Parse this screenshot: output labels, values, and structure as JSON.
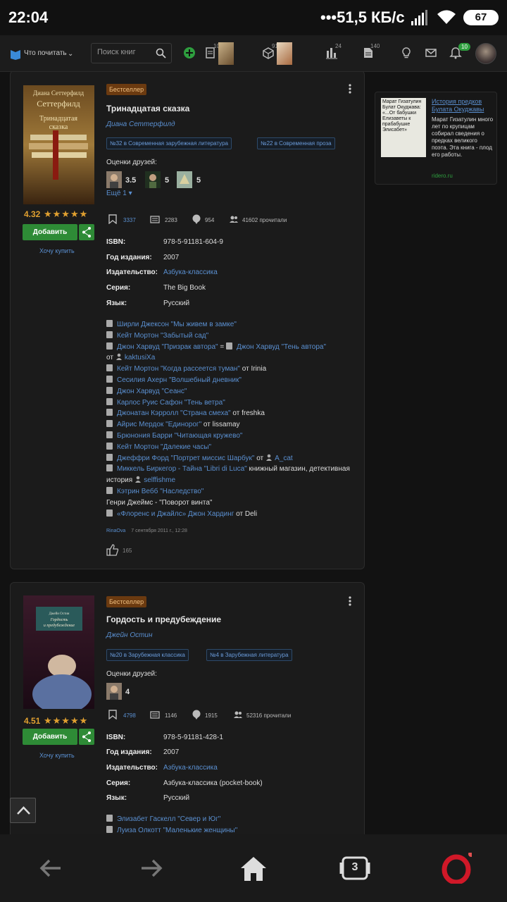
{
  "status": {
    "time": "22:04",
    "network": "•••51,5 КБ/с",
    "battery": "67"
  },
  "nav": {
    "title": "Что почитать",
    "search_placeholder": "Поиск книг",
    "counts": {
      "books": "101",
      "shelf": "91",
      "stats": "24",
      "quotes": "140"
    },
    "notif_badge": "10"
  },
  "books": [
    {
      "tag": "Бестселлер",
      "title": "Тринадцатая сказка",
      "author": "Диана Сеттерфилд",
      "cover_author": "Диана Сеттерфилд",
      "cover_title": "Тринадцатая сказка",
      "rating": "4.32",
      "add_label": "Добавить",
      "want_buy": "Хочу купить",
      "ranks": [
        "№32 в Современная зарубежная литература",
        "№22 в Современная проза"
      ],
      "friends_label": "Оценки друзей:",
      "friend_scores": [
        "3.5",
        "5",
        "5"
      ],
      "more": "Ещё 1",
      "stats": {
        "saves": "3337",
        "quotes": "2283",
        "reviews": "954",
        "readers": "41602 прочитали"
      },
      "fields": [
        {
          "label": "ISBN:",
          "value": "978-5-91181-604-9",
          "link": false
        },
        {
          "label": "Год издания:",
          "value": "2007",
          "link": false
        },
        {
          "label": "Издательство:",
          "value": "Азбука-классика",
          "link": true
        },
        {
          "label": "Серия:",
          "value": "The Big Book",
          "link": false
        },
        {
          "label": "Язык:",
          "value": "Русский",
          "link": false
        }
      ],
      "recs": {
        "r1": "Ширли Джексон \"Мы живем в замке\"",
        "r2": "Кейт Мортон \"Забытый сад\"",
        "r3a": "Джон Харвуд \"Призрак автора\"",
        "r3eq": " = ",
        "r3b": "Джон Харвуд \"Тень автора\"",
        "r3from": "от",
        "r3user": "kaktusiXa",
        "r4": "Кейт Мортон \"Когда рассеется туман\"",
        "r4from": " от Irinia",
        "r5": "Сесилия Ахерн \"Волшебный дневник\"",
        "r6": "Джон Харвуд \"Сеанс\"",
        "r7": "Карлос Руис Сафон \"Тень ветра\"",
        "r8": "Джонатан Кэрролл \"Страна смеха\"",
        "r8from": " от freshka",
        "r9": "Айрис Мердок \"Единорог\"",
        "r9from": " от lissamay",
        "r10": "Брюнония Барри \"Читающая кружево\"",
        "r11": "Кейт Мортон \"Далекие часы\"",
        "r12": "Джеффри Форд \"Портрет миссис Шарбук\"",
        "r12from": " от",
        "r12user": "A_cat",
        "r13": "Миккель Биркегор - Тайна \"Libri di Luca\"",
        "r13tail": " книжный магазин, детективная история",
        "r13user": "selffishme",
        "r14": "Кэтрин Вебб \"Наследство\"",
        "r15": "Генри Джеймс - \"Поворот винта\"",
        "r16": "«Флоренс и Джайлс» Джон Хардинг",
        "r16from": " от Deli"
      },
      "meta_user": "RinaOva",
      "meta_date": "7 сентября 2011 г., 12:28",
      "likes": "165"
    },
    {
      "tag": "Бестселлер",
      "title": "Гордость и предубеждение",
      "author": "Джейн Остин",
      "cover_author": "Джейн Остин",
      "cover_title": "Гордость и предубеждение",
      "rating": "4.51",
      "add_label": "Добавить",
      "want_buy": "Хочу купить",
      "ranks": [
        "№20 в Зарубежная классика",
        "№4 в Зарубежная литература"
      ],
      "friends_label": "Оценки друзей:",
      "friend_scores": [
        "4"
      ],
      "stats": {
        "saves": "4798",
        "quotes": "1146",
        "reviews": "1915",
        "readers": "52316 прочитали"
      },
      "fields": [
        {
          "label": "ISBN:",
          "value": "978-5-91181-428-1",
          "link": false
        },
        {
          "label": "Год издания:",
          "value": "2007",
          "link": false
        },
        {
          "label": "Издательство:",
          "value": "Азбука-классика",
          "link": true
        },
        {
          "label": "Серия:",
          "value": "Азбука-классика (pocket-book)",
          "link": false
        },
        {
          "label": "Язык:",
          "value": "Русский",
          "link": false
        }
      ],
      "recs": {
        "r1": "Элизабет Гаскелл \"Север и Юг\"",
        "r2": "Луиза Олкотт \"Маленькие женщины\""
      }
    }
  ],
  "ad": {
    "img_text": "Марат Гизатулин Булат Окуджава: «...От бабушки Елизаветы к прабабушке Элисабет»",
    "link": "История предков Булата Окуджавы",
    "text": "Марат Гизатулин много лет по крупицам собирал сведения о предках великого поэта. Эта книга - плод его работы.",
    "source": "ridero.ru"
  },
  "tabs_count": "3",
  "colors": {
    "accent_green": "#2e8b36",
    "link_blue": "#5a8fd0",
    "rating_orange": "#e0a030"
  }
}
